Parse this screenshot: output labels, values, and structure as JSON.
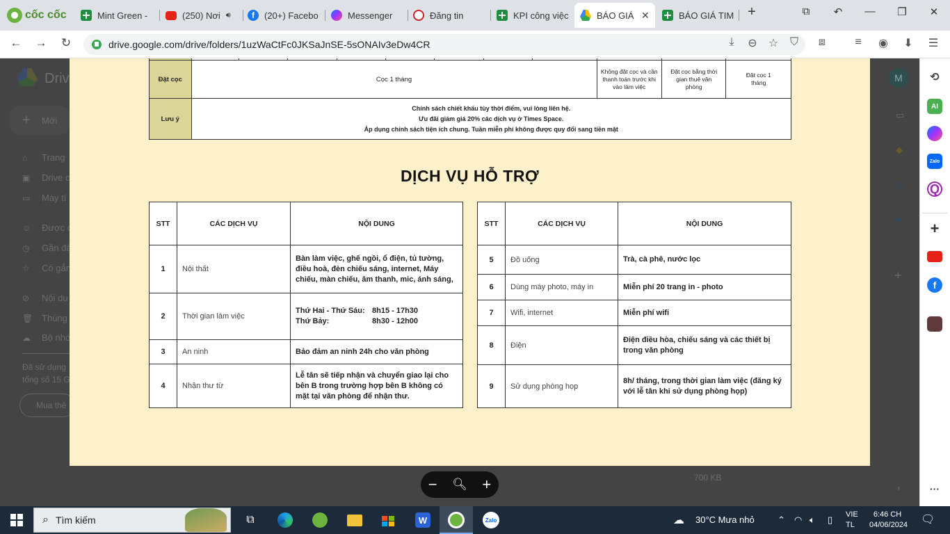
{
  "browser": {
    "brand": "cốc cốc",
    "tabs": [
      {
        "label": "Mint Green -",
        "icon": "sheets-icon"
      },
      {
        "label": "(250) Nơi",
        "icon": "youtube-icon"
      },
      {
        "label": "(20+) Facebo",
        "icon": "facebook-icon"
      },
      {
        "label": "Messenger",
        "icon": "messenger-icon"
      },
      {
        "label": "Đăng tin",
        "icon": "clock-icon"
      },
      {
        "label": "KPI công việc",
        "icon": "sheets-icon"
      },
      {
        "label": "BÁO GIÁ",
        "icon": "drive-icon",
        "active": true
      },
      {
        "label": "BÁO GIÁ TIM",
        "icon": "sheets-icon"
      }
    ],
    "url": "drive.google.com/drive/folders/1uzWaCtFc0JKSaJnSE-5sONAIv3eDw4CR"
  },
  "drive_bg": {
    "title": "Drive",
    "new_label": "Mới",
    "nav": [
      "Trang",
      "Drive c",
      "Máy tí",
      "Được c",
      "Gần đâ",
      "Có gắn",
      "Nội du",
      "Thùng",
      "Bộ nhớ"
    ],
    "storage": [
      "Đã sử dụng",
      "tổng số 15 G"
    ],
    "buy_label": "Mua thê",
    "avatar_letter": "M",
    "file_size": "700 KB"
  },
  "document": {
    "top_table": {
      "row1_label": "Đặt cọc",
      "row1_main": "Cọc 1 tháng",
      "row1_cells": [
        "Không đặt cọc và cần thanh toán trước khi vào làm việc",
        "Đặt cọc bằng thời gian thuê văn phòng",
        "Đặt cọc 1 tháng"
      ],
      "row2_label": "Lưu ý",
      "row2_lines": [
        "Chính sách chiết khấu tùy thời điểm, vui lòng liên hệ.",
        "Ưu đãi giảm giá 20% các dịch vụ ở Times Space.",
        "Áp dụng chính sách tiện ích chung. Tuần miễn phí không được quy đổi sang tiền mặt"
      ]
    },
    "heading": "DỊCH VỤ HỖ TRỢ",
    "headers": {
      "stt": "STT",
      "service": "CÁC DỊCH VỤ",
      "content": "NỘI DUNG"
    },
    "left_rows": [
      {
        "stt": "1",
        "service": "Nội thất",
        "content": "Bàn làm việc, ghế ngồi, ổ điện, tủ tường, điều hoà, đèn chiếu sáng, internet, Máy chiếu, màn chiếu, âm thanh, mic, ánh sáng,"
      },
      {
        "stt": "2",
        "service": "Thời gian làm việc",
        "content_rows": [
          [
            "Thứ Hai - Thứ Sáu:",
            "8h15 - 17h30"
          ],
          [
            "Thứ Bảy:",
            "8h30 - 12h00"
          ]
        ]
      },
      {
        "stt": "3",
        "service": "An ninh",
        "content": "Bảo đảm an ninh 24h cho văn phòng"
      },
      {
        "stt": "4",
        "service": "Nhận thư từ",
        "content": "Lễ tân sẽ tiếp nhận và chuyển giao lại cho bên B trong trường hợp bên B không có mặt tại văn phòng để nhận thư."
      }
    ],
    "right_rows": [
      {
        "stt": "5",
        "service": "Đồ uống",
        "content": "Trà, cà phê, nước lọc"
      },
      {
        "stt": "6",
        "service": "Dùng máy photo, máy in",
        "content": "Miễn phí 20 trang in - photo"
      },
      {
        "stt": "7",
        "service": "Wifi, internet",
        "content": "Miễn phí wifi"
      },
      {
        "stt": "8",
        "service": "Điện",
        "content": "Điện điều hòa, chiếu sáng và các thiết bị trong văn phòng"
      },
      {
        "stt": "9",
        "service": "Sử dụng phòng họp",
        "content": "8h/ tháng, trong thời gian làm việc (đăng ký với lễ tân khi sử dụng phòng họp)"
      }
    ]
  },
  "zoom": {
    "minus": "−",
    "plus": "+"
  },
  "sidebar": [
    {
      "icon": "history-icon",
      "label": "",
      "color": "#ffffff"
    },
    {
      "icon": "ai-icon",
      "label": "AI",
      "color": "#4caf50"
    },
    {
      "icon": "messenger-icon",
      "label": "",
      "color": "#8a3ffc"
    },
    {
      "icon": "zalo-icon",
      "label": "Zalo",
      "color": "#0068ff"
    },
    {
      "icon": "q-icon",
      "label": "Q",
      "color": "#9c27b0"
    },
    {
      "icon": "add-icon",
      "label": "+",
      "color": "#ffffff"
    },
    {
      "icon": "youtube-icon",
      "label": "",
      "color": "#e62117"
    },
    {
      "icon": "facebook-icon",
      "label": "f",
      "color": "#1877f2"
    },
    {
      "icon": "avatar-icon",
      "label": "",
      "color": "#603a3a"
    }
  ],
  "taskbar": {
    "search_label": "Tìm kiếm",
    "weather": "30°C  Mưa nhỏ",
    "lang": [
      "VIE",
      "TL"
    ],
    "time": "6:46 CH",
    "date": "04/06/2024"
  }
}
